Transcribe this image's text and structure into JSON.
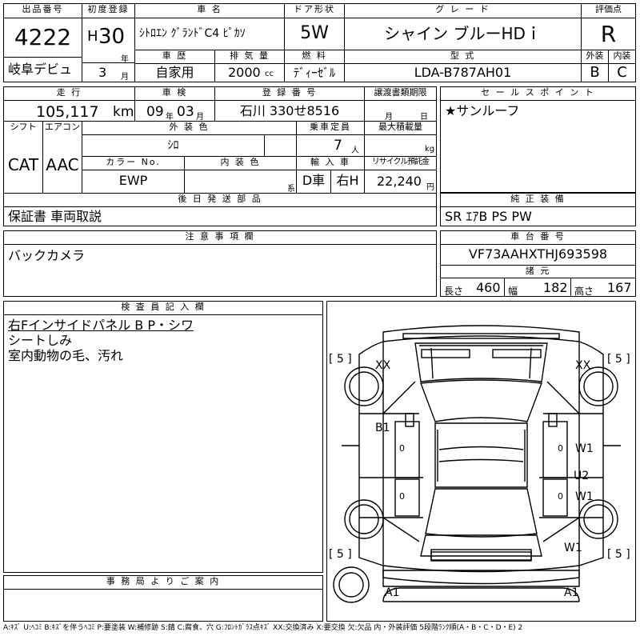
{
  "hdr": {
    "lot_label": "出品番号",
    "lot": "4222",
    "venue": "岐阜デビュ",
    "first_reg_label": "初度登録",
    "era": "H",
    "year": "30",
    "year_unit": "年",
    "month": "3",
    "month_unit": "月",
    "name_label": "車 名",
    "name": "ｼﾄﾛｴﾝ ｸﾞﾗﾝﾄﾞC4 ﾋﾟｶｿ",
    "door_label": "ドア形状",
    "door": "5W",
    "grade_label": "グ レ ー ド",
    "grade": "シャイン ブルーHDｉ",
    "score_label": "評価点",
    "score": "R",
    "history_label": "車 歴",
    "history": "自家用",
    "disp_label": "排 気 量",
    "disp": "2000",
    "disp_unit": "cc",
    "fuel_label": "燃 料",
    "fuel": "ﾃﾞｨｰｾﾞﾙ",
    "model_label": "型 式",
    "model": "LDA-B787AH01",
    "ext_label": "外装",
    "ext": "B",
    "int_label": "内装",
    "int": "C"
  },
  "s2": {
    "mileage_label": "走 行",
    "mileage": "105,117",
    "mileage_unit": "km",
    "inspect_label": "車 検",
    "insp_year": "09",
    "insp_year_unit": "年",
    "insp_month": "03",
    "insp_month_unit": "月",
    "regno_label": "登 録 番 号",
    "regno": "石川 330せ8516",
    "transfer_label": "譲渡書類期限",
    "transfer_month_unit": "月",
    "transfer_day_unit": "日",
    "shift_label": "シフト",
    "shift": "CAT",
    "ac_label": "エアコン",
    "ac": "AAC",
    "color_label": "外 装 色",
    "color": "ｼﾛ",
    "capacity_label": "乗車定員",
    "capacity": "7",
    "capacity_unit": "人",
    "load_label": "最大積載量",
    "load_unit": "kg",
    "colorno_label": "カラー No.",
    "colorno": "EWP",
    "intcolor_label": "内 装 色",
    "intcolor_unit": "系",
    "import_label": "輸 入 車",
    "import": "D車",
    "handle": "右H",
    "recycle_label": "リサイクル預託金",
    "recycle": "22,240",
    "recycle_unit": "円",
    "sales_label": "セ ー ル ス ポ イ ン ト",
    "sales": "★サンルーフ",
    "later_label": "後 日 発 送 部 品",
    "later": "保証書 車両取説",
    "equip_label": "純 正 装 備",
    "equip": "SR ｴｱB PS PW"
  },
  "s3": {
    "caution_label": "注 意 事 項 欄",
    "caution": "バックカメラ",
    "chassis_label": "車 台 番 号",
    "chassis": "VF73AAHXTHJ693598",
    "dims_label": "諸 元",
    "length_label": "長さ",
    "length": "460",
    "width_label": "幅",
    "width": "182",
    "height_label": "高さ",
    "height": "167"
  },
  "inspector": {
    "label": "検 査 員 記 入 欄",
    "lines": [
      "右Fインサイドパネル B P・シワ",
      "シートしみ",
      "室内動物の毛、汚れ"
    ]
  },
  "office": {
    "label": "事 務 局 よ り ご 案 内"
  },
  "diagram": {
    "tire_fl": "[ 5 ]",
    "tire_fr": "[ 5 ]",
    "tire_rl": "[ 5 ]",
    "tire_rr": "[ 5 ]",
    "xx_l": "XX",
    "xx_r": "XX",
    "b1": "B1",
    "u2": "U2",
    "w1_a": "W1",
    "w1_b": "W1",
    "w1_c": "W1",
    "zero_l1": "0",
    "zero_l2": "0",
    "zero_r1": "0",
    "zero_r2": "0",
    "a1_l": "A1",
    "a1_r": "A1"
  },
  "legend": "A:ｷｽﾞ U:ﾍｺﾐ B:ｷｽﾞを伴うﾍｺﾐ P:要塗装 W:補修跡 S:錆 C:腐食、穴 G:ﾌﾛﾝﾄｶﾞﾗｽ点ｷｽﾞ XX:交換済み X:要交換 欠:欠品 内・外装評価 5段階ﾗﾝｸ順(A・B・C・D・E) 2"
}
